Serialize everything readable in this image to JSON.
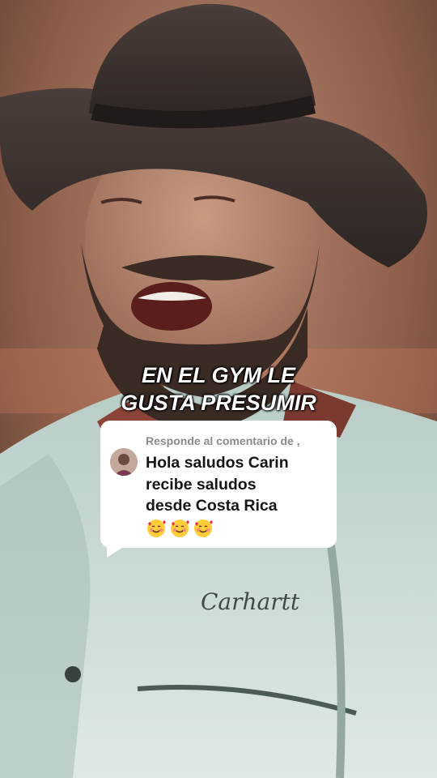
{
  "video": {
    "caption_lines": [
      "EN EL GYM LE",
      "GUSTA PRESUMIR"
    ],
    "shirt_logo": "Carhartt"
  },
  "comment": {
    "reply_label": "Responde al comentario de ,",
    "text_lines": [
      "Hola saludos Carin",
      "recibe saludos",
      "desde Costa Rica"
    ],
    "emojis": [
      "smiling-face-with-hearts",
      "smiling-face-with-hearts",
      "smiling-face-with-hearts"
    ]
  },
  "colors": {
    "caption": "#ffffff",
    "card_bg": "#ffffff",
    "reply_label": "#8a8a8a",
    "comment_text": "#161616"
  }
}
